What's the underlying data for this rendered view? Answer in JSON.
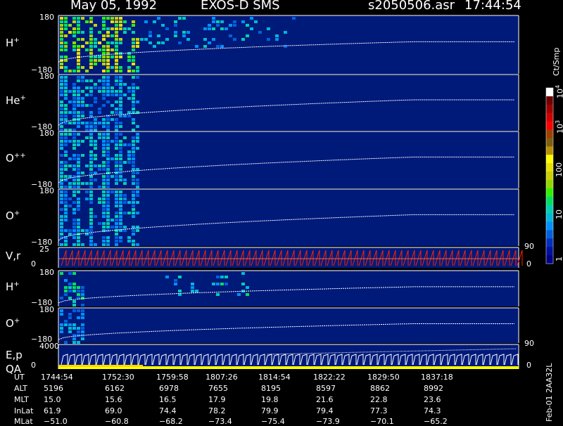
{
  "header": {
    "date": "May 05, 1992",
    "instrument": "EXOS-D SMS",
    "file": "s2050506.asr",
    "time": "17:44:54"
  },
  "colorbar": {
    "unit": "Ct/Smp",
    "ticks": [
      "1",
      "10",
      "100",
      "10",
      "10"
    ],
    "exponents": [
      "",
      "",
      "",
      "3",
      "4"
    ],
    "colors": [
      "#000088",
      "#0010a0",
      "#0030c0",
      "#0060e0",
      "#0090ff",
      "#00b8d8",
      "#00d0b0",
      "#00e060",
      "#30f000",
      "#90d800",
      "#c8d000",
      "#e8e000",
      "#ffff00",
      "#b89000",
      "#806010",
      "#a04000",
      "#ff0000",
      "#d00000",
      "#a00000",
      "#700000",
      "#ffffff"
    ]
  },
  "panels": [
    {
      "name": "h-plus",
      "label": "H",
      "sup": "+",
      "ymax": "180",
      "ymin": "−180"
    },
    {
      "name": "he-plus",
      "label": "He",
      "sup": "+",
      "ymax": "180",
      "ymin": "−180"
    },
    {
      "name": "o-plus-plus",
      "label": "O",
      "sup": "++",
      "ymax": "180",
      "ymin": "−180"
    },
    {
      "name": "o-plus",
      "label": "O",
      "sup": "+",
      "ymax": "180",
      "ymin": "−180"
    },
    {
      "name": "velocity",
      "label": "V,r",
      "sup": "",
      "ymax": "25",
      "ymin": "0",
      "right_max": "90",
      "right_min": "0"
    },
    {
      "name": "h-plus-2",
      "label": "H",
      "sup": "+",
      "ymax": "180",
      "ymin": "−180"
    },
    {
      "name": "o-plus-2",
      "label": "O",
      "sup": "+",
      "ymax": "180",
      "ymin": "−180"
    },
    {
      "name": "energy",
      "label": "E,p",
      "label2": "QA",
      "sup": "",
      "ymax": "4000",
      "ymin": "0",
      "right_max": "90",
      "right_min": "0"
    }
  ],
  "table": {
    "row_labels": [
      "UT",
      "ALT",
      "MLT",
      "InLat",
      "MLat"
    ],
    "columns": [
      [
        "1744:54",
        "5196",
        "15.0",
        "61.9",
        "−51.0"
      ],
      [
        "1752:30",
        "6162",
        "15.6",
        "69.0",
        "−60.8"
      ],
      [
        "1759:58",
        "6978",
        "16.5",
        "74.4",
        "−68.2"
      ],
      [
        "1807:26",
        "7655",
        "17.9",
        "78.2",
        "−73.4"
      ],
      [
        "1814:54",
        "8195",
        "19.8",
        "79.9",
        "−75.4"
      ],
      [
        "1822:22",
        "8597",
        "21.6",
        "79.4",
        "−73.9"
      ],
      [
        "1829:50",
        "8862",
        "22.8",
        "77.3",
        "−70.1"
      ],
      [
        "1837:18",
        "8992",
        "23.6",
        "74.3",
        "−65.2"
      ]
    ]
  },
  "footer_code": "Feb-01 2AA32L",
  "chart_data": {
    "type": "heatmap",
    "title": "May 05, 1992   EXOS-D SMS",
    "time_ticks": [
      "1744:54",
      "1752:30",
      "1759:58",
      "1807:26",
      "1814:54",
      "1822:22",
      "1829:50",
      "1837:18"
    ],
    "colorbar_range": [
      1,
      10000
    ],
    "colorbar_scale": "log",
    "series": [
      {
        "name": "H+",
        "ylim": [
          -180,
          180
        ]
      },
      {
        "name": "He+",
        "ylim": [
          -180,
          180
        ]
      },
      {
        "name": "O++",
        "ylim": [
          -180,
          180
        ]
      },
      {
        "name": "O+",
        "ylim": [
          -180,
          180
        ]
      },
      {
        "name": "V,r",
        "ylim": [
          0,
          25
        ]
      },
      {
        "name": "H+",
        "ylim": [
          -180,
          180
        ]
      },
      {
        "name": "O+",
        "ylim": [
          -180,
          180
        ]
      },
      {
        "name": "E,p",
        "ylim": [
          0,
          4000
        ]
      }
    ]
  }
}
